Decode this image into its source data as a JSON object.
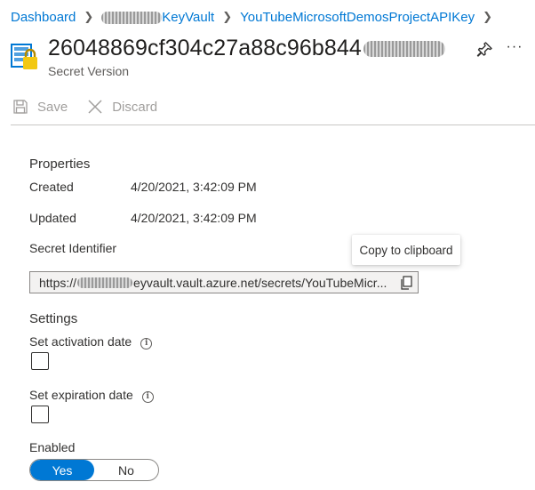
{
  "breadcrumb": {
    "items": [
      {
        "label": "Dashboard"
      },
      {
        "label": "KeyVault"
      },
      {
        "label": "YouTubeMicrosoftDemosProjectAPIKey"
      }
    ]
  },
  "header": {
    "title": "26048869cf304c27a88c96b844",
    "subtitle": "Secret Version",
    "icon": "key-vault-icon"
  },
  "toolbar": {
    "save_label": "Save",
    "discard_label": "Discard"
  },
  "properties": {
    "heading": "Properties",
    "created_label": "Created",
    "created_value": "4/20/2021, 3:42:09 PM",
    "updated_label": "Updated",
    "updated_value": "4/20/2021, 3:42:09 PM",
    "identifier_label": "Secret Identifier",
    "identifier_prefix": "https://",
    "identifier_value": "eyvault.vault.azure.net/secrets/YouTubeMicr...",
    "tooltip": "Copy to clipboard"
  },
  "settings": {
    "heading": "Settings",
    "activation_label": "Set activation date",
    "expiration_label": "Set expiration date",
    "enabled_label": "Enabled",
    "enabled_yes": "Yes",
    "enabled_no": "No",
    "enabled_selected": "Yes"
  },
  "colors": {
    "accent": "#0078d4",
    "disabled_text": "#a19f9d"
  }
}
